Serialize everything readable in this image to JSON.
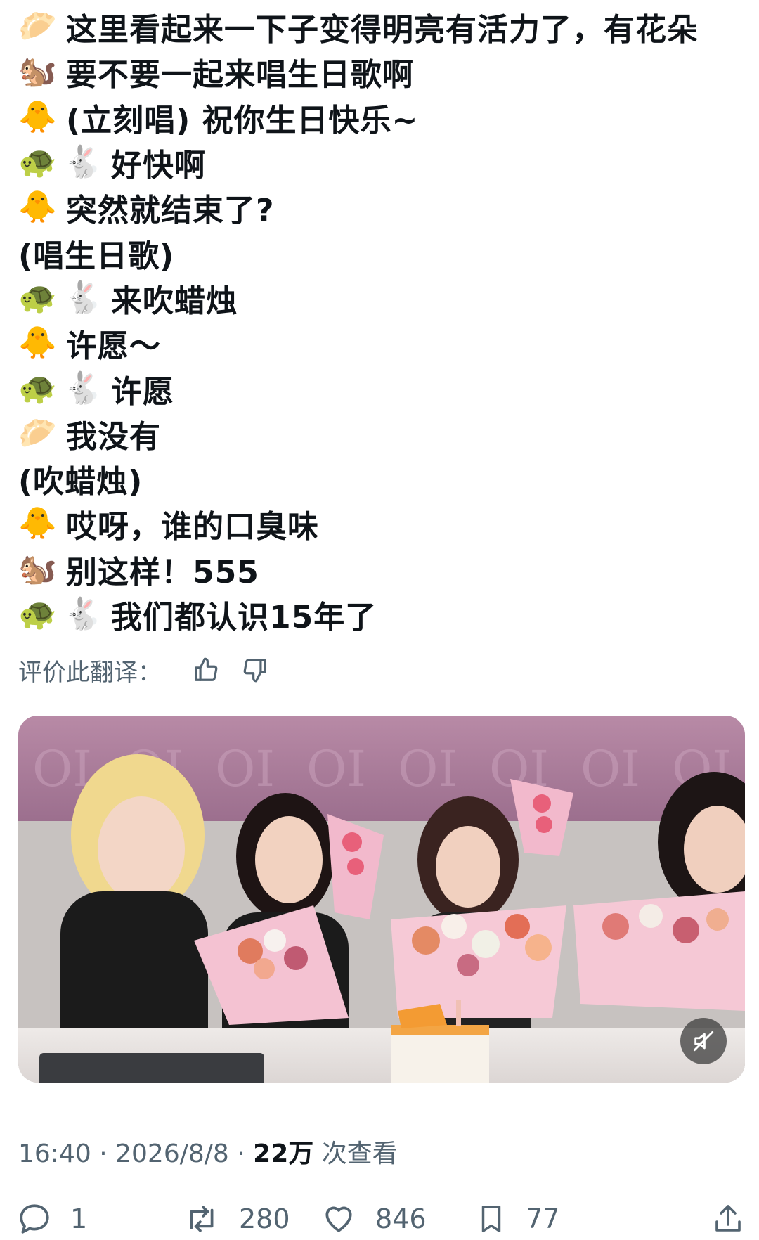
{
  "tweet": {
    "lines": [
      {
        "speakers": [
          "🥟"
        ],
        "text": "这里看起来一下子变得明亮有活力了，有花朵"
      },
      {
        "speakers": [
          "🐿️"
        ],
        "text": "要不要一起来唱生日歌啊"
      },
      {
        "speakers": [
          "🐥"
        ],
        "text": "(立刻唱) 祝你生日快乐~"
      },
      {
        "speakers": [
          "🐢",
          "🐇"
        ],
        "text": "好快啊"
      },
      {
        "speakers": [
          "🐥"
        ],
        "text": "突然就结束了?"
      },
      {
        "speakers": [],
        "text": "(唱生日歌)"
      },
      {
        "speakers": [
          "🐢",
          "🐇"
        ],
        "text": "来吹蜡烛"
      },
      {
        "speakers": [
          "🐥"
        ],
        "text": "许愿～"
      },
      {
        "speakers": [
          "🐢",
          "🐇"
        ],
        "text": "许愿"
      },
      {
        "speakers": [
          "🥟"
        ],
        "text": "我没有"
      },
      {
        "speakers": [],
        "text": "(吹蜡烛)"
      },
      {
        "speakers": [
          "🐥"
        ],
        "text": "哎呀，谁的口臭味"
      },
      {
        "speakers": [
          "🐿️"
        ],
        "text": "别这样！555"
      },
      {
        "speakers": [
          "🐢",
          "🐇"
        ],
        "text": "我们都认识15年了"
      }
    ]
  },
  "rate_translation": {
    "label": "评价此翻译：",
    "thumbs_up_icon": "thumbs-up-icon",
    "thumbs_down_icon": "thumbs-down-icon"
  },
  "media": {
    "kind": "video",
    "mute_icon": "speaker-muted-icon"
  },
  "meta": {
    "time": "16:40",
    "separator": "·",
    "date": "2026/8/8",
    "views_count": "22万",
    "views_label": "次查看"
  },
  "actions": {
    "reply_count": "1",
    "retweet_count": "280",
    "like_count": "846",
    "bookmark_count": "77"
  },
  "colors": {
    "text": "#0f1419",
    "secondary": "#536471"
  }
}
